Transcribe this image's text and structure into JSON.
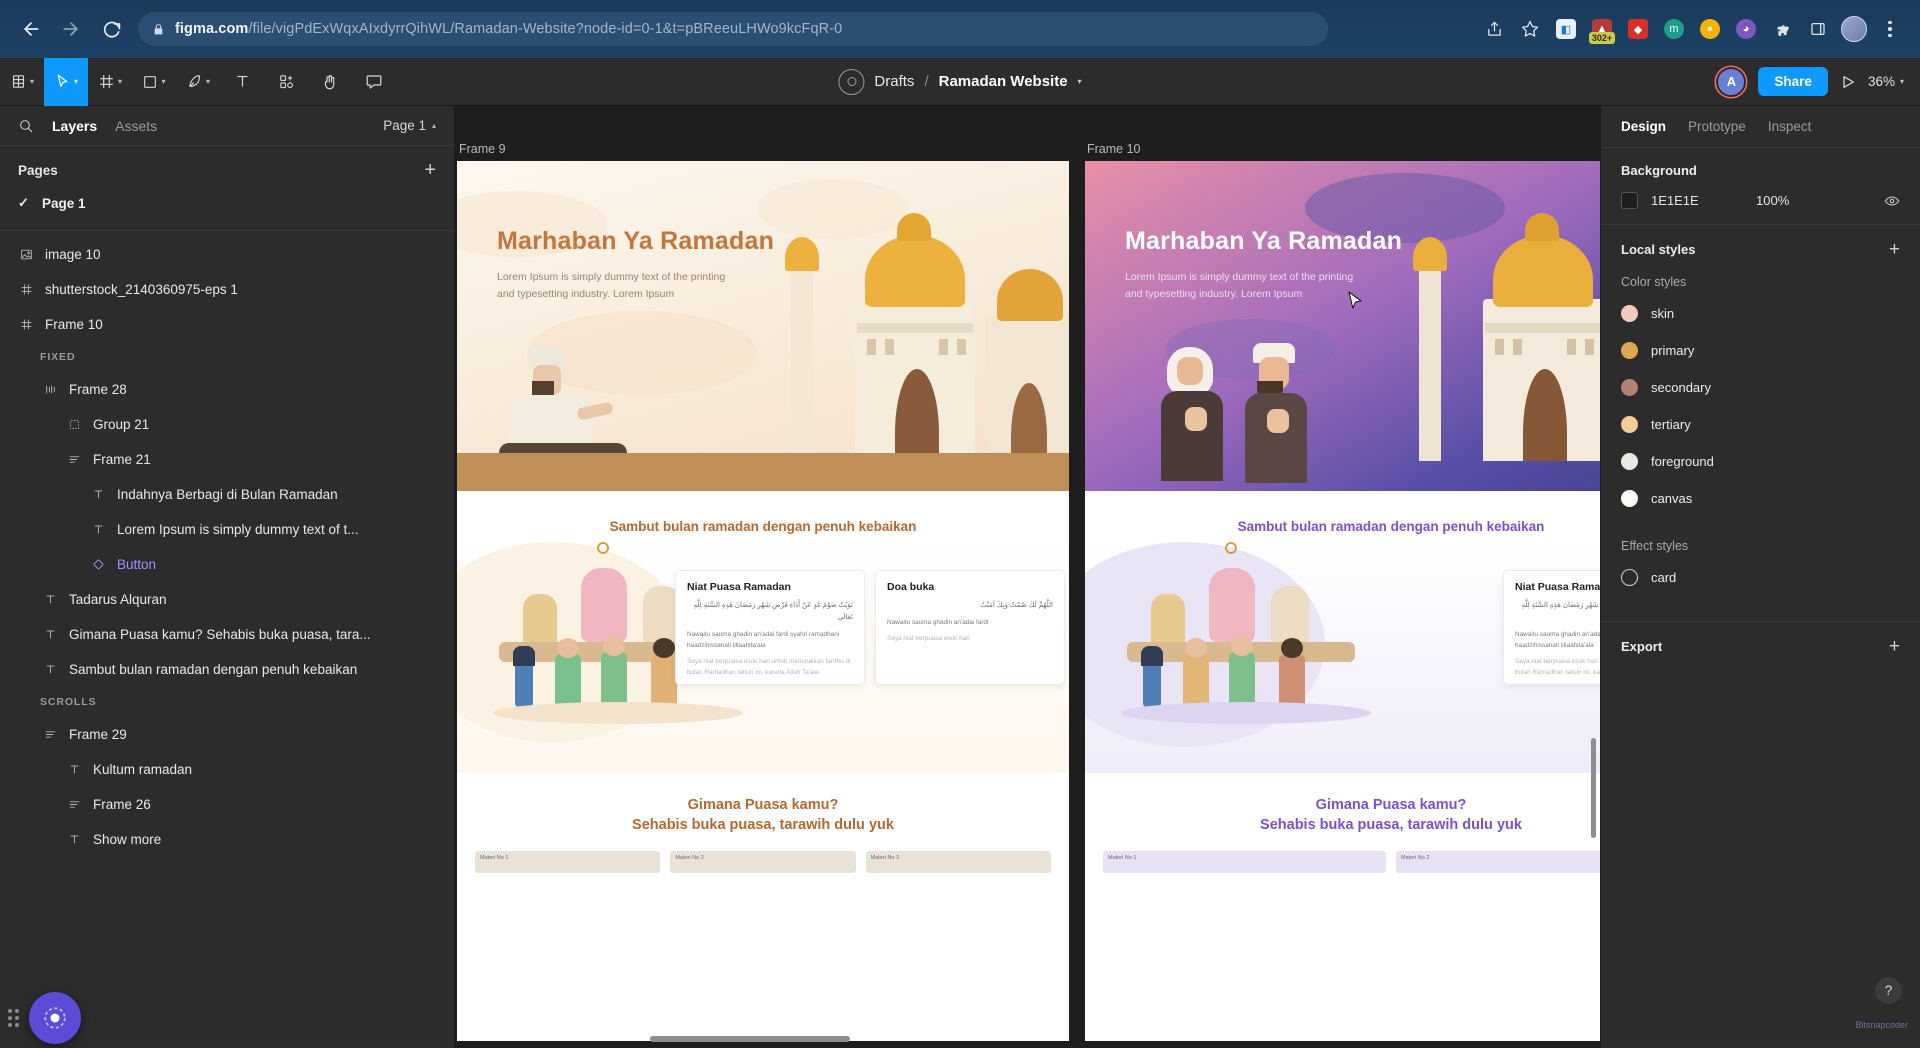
{
  "browser": {
    "url_domain": "figma.com",
    "url_path": "/file/vigPdExWqxAIxdyrrQihWL/Ramadan-Website?node-id=0-1&t=pBReeuLHWo9kcFqR-0",
    "back_icon": "back-arrow-icon",
    "forward_icon": "forward-arrow-icon",
    "reload_icon": "reload-icon",
    "lock_icon": "lock-icon",
    "share_icon": "share-icon",
    "bookmark_icon": "star-icon",
    "ext_badge": "302+",
    "menu_icon": "kebab-menu-icon"
  },
  "figma_toolbar": {
    "menu_label": "figma-menu",
    "tools": [
      {
        "name": "main-menu",
        "icon": "figma-logo-icon",
        "caret": true,
        "active": false
      },
      {
        "name": "move-tool",
        "icon": "cursor-icon",
        "caret": true,
        "active": true
      },
      {
        "name": "frame-tool",
        "icon": "frame-icon",
        "caret": true,
        "active": false
      },
      {
        "name": "shape-tool",
        "icon": "rectangle-icon",
        "caret": true,
        "active": false
      },
      {
        "name": "pen-tool",
        "icon": "pen-icon",
        "caret": true,
        "active": false
      },
      {
        "name": "text-tool",
        "icon": "text-icon",
        "caret": false,
        "active": false
      },
      {
        "name": "resources-tool",
        "icon": "components-icon",
        "caret": false,
        "active": false
      },
      {
        "name": "hand-tool",
        "icon": "hand-icon",
        "caret": false,
        "active": false
      },
      {
        "name": "comment-tool",
        "icon": "comment-icon",
        "caret": false,
        "active": false
      }
    ],
    "breadcrumb_root": "Drafts",
    "breadcrumb_sep": "/",
    "breadcrumb_file": "Ramadan Website",
    "avatar_initial": "A",
    "share_label": "Share",
    "present_icon": "play-icon",
    "zoom_level": "36%"
  },
  "left_panel": {
    "search_icon": "search-icon",
    "tabs": [
      {
        "label": "Layers",
        "active": true
      },
      {
        "label": "Assets",
        "active": false
      }
    ],
    "page_selector": "Page 1",
    "pages_header": "Pages",
    "add_page_icon": "plus-icon",
    "current_page": "Page 1",
    "layers": [
      {
        "label": "image 10",
        "icon": "image-icon",
        "indent": 0,
        "style": "normal"
      },
      {
        "label": "shutterstock_2140360975-eps 1",
        "icon": "frame-icon",
        "indent": 0,
        "style": "normal"
      },
      {
        "label": "Frame 10",
        "icon": "frame-icon",
        "indent": 0,
        "style": "normal"
      },
      {
        "label": "FIXED",
        "icon": "section",
        "indent": 1,
        "style": "section"
      },
      {
        "label": "Frame 28",
        "icon": "autolayout-icon",
        "indent": 1,
        "style": "normal"
      },
      {
        "label": "Group 21",
        "icon": "group-icon",
        "indent": 2,
        "style": "normal"
      },
      {
        "label": "Frame 21",
        "icon": "autolayout-v-icon",
        "indent": 2,
        "style": "normal"
      },
      {
        "label": "Indahnya Berbagi di Bulan Ramadan",
        "icon": "text-icon",
        "indent": 3,
        "style": "normal"
      },
      {
        "label": "Lorem Ipsum is simply dummy text of t...",
        "icon": "text-icon",
        "indent": 3,
        "style": "normal"
      },
      {
        "label": "Button",
        "icon": "component-icon",
        "indent": 3,
        "style": "purple"
      },
      {
        "label": "Tadarus Alquran",
        "icon": "text-icon",
        "indent": 1,
        "style": "normal"
      },
      {
        "label": "Gimana Puasa kamu? Sehabis buka puasa, tara...",
        "icon": "text-icon",
        "indent": 1,
        "style": "normal"
      },
      {
        "label": "Sambut bulan ramadan dengan penuh kebaikan",
        "icon": "text-icon",
        "indent": 1,
        "style": "normal"
      },
      {
        "label": "SCROLLS",
        "icon": "section",
        "indent": 1,
        "style": "section"
      },
      {
        "label": "Frame 29",
        "icon": "autolayout-v-icon",
        "indent": 1,
        "style": "normal"
      },
      {
        "label": "Kultum ramadan",
        "icon": "text-icon",
        "indent": 2,
        "style": "normal"
      },
      {
        "label": "Frame 26",
        "icon": "autolayout-v-icon",
        "indent": 2,
        "style": "normal"
      },
      {
        "label": "Show more",
        "icon": "text-icon",
        "indent": 2,
        "style": "normal"
      }
    ],
    "plugin_icon": "plugin-running-icon",
    "grip_icon": "drag-grip-icon"
  },
  "right_panel": {
    "tabs": [
      {
        "label": "Design",
        "active": true
      },
      {
        "label": "Prototype",
        "active": false
      },
      {
        "label": "Inspect",
        "active": false
      }
    ],
    "background": {
      "title": "Background",
      "hex": "1E1E1E",
      "swatch": "#1e1e1e",
      "opacity": "100%",
      "visibility_icon": "eye-icon"
    },
    "local_styles": {
      "title": "Local styles",
      "add_icon": "plus-icon",
      "color_styles_label": "Color styles",
      "color_styles": [
        {
          "name": "skin",
          "color": "#f3c9bd"
        },
        {
          "name": "primary",
          "color": "#e0a455"
        },
        {
          "name": "secondary",
          "color": "#b08271"
        },
        {
          "name": "tertiary",
          "color": "#f4cc9a"
        },
        {
          "name": "foreground",
          "color": "#e9e9e4"
        },
        {
          "name": "canvas",
          "color": "#fdfbf6"
        }
      ],
      "effect_styles_label": "Effect styles",
      "effect_styles": [
        {
          "name": "card",
          "icon": "effect-circle-icon"
        }
      ]
    },
    "export": {
      "title": "Export",
      "add_icon": "plus-icon"
    },
    "help_label": "?",
    "watermark": "Bitsnapcoder"
  },
  "canvas": {
    "frames": [
      {
        "title": "Frame 9",
        "theme": "light",
        "hero_heading": "Marhaban Ya Ramadan",
        "hero_paragraph": "Lorem Ipsum is simply dummy text of the printing and typesetting industry. Lorem Ipsum",
        "section_title": "Sambut bulan ramadan dengan penuh kebaikan",
        "cards": [
          {
            "title": "Niat Puasa Ramadan",
            "arabic": "نَوَيْتُ صَوْمَ غَدٍ عَنْ أَدَاءِ فَرْضِ شَهْرِ رَمَضَانَ هَذِهِ السَّنَةِ لِلَّهِ تَعَالَى",
            "latin": "Nawaitu sauma ghadin an'adai fardi syahri ramadhani haadzihissanati lillaahita'ala",
            "translation": "Saya niat berpuasa esok hari untuk menunaikan fardhu di bulan Ramadhan tahun ini, karena Allah Ta'ala."
          },
          {
            "title": "Doa buka",
            "arabic": "اللَّهُمَّ لَكَ صُمْتُ وَبِكَ آمَنْتُ",
            "latin": "Nawaitu sauma ghadin an'adai fardi",
            "translation": "Saya niat berpuasa esok hari"
          }
        ],
        "cta_line1": "Gimana Puasa kamu?",
        "cta_line2": "Sehabis buka puasa, tarawih dulu yuk",
        "thumbs": [
          "Materi No 1",
          "Materi No 2",
          "Materi No 3"
        ]
      },
      {
        "title": "Frame 10",
        "theme": "dark",
        "hero_heading": "Marhaban Ya Ramadan",
        "hero_paragraph": "Lorem Ipsum is simply dummy text of the printing and typesetting industry. Lorem Ipsum",
        "section_title": "Sambut bulan ramadan dengan penuh kebaikan",
        "cards": [
          {
            "title": "Niat Puasa Ramadan",
            "arabic": "نَوَيْتُ صَوْمَ غَدٍ عَنْ أَدَاءِ فَرْضِ شَهْرِ رَمَضَانَ هَذِهِ السَّنَةِ لِلَّهِ تَعَالَى",
            "latin": "Nawaitu sauma ghadin an'adai fardi syahri ramadhani haadzihissanati lillaahita'ala",
            "translation": "Saya niat berpuasa esok hari untuk menunaikan fardhu di bulan Ramadhan tahun ini, karena Allah Ta'ala."
          }
        ],
        "cta_line1": "Gimana Puasa kamu?",
        "cta_line2": "Sehabis buka puasa, tarawih dulu yuk",
        "thumbs": [
          "Materi No 1",
          "Materi No 2"
        ]
      }
    ],
    "cursor_icon": "mouse-cursor-icon",
    "h_scrollbar": "horizontal-scrollbar",
    "v_scrollbar": "vertical-scrollbar"
  }
}
